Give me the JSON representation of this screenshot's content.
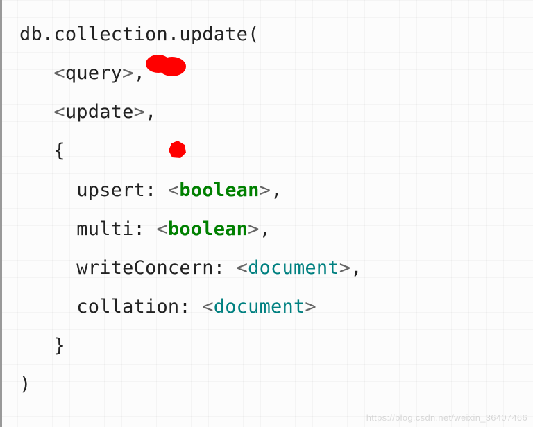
{
  "code": {
    "line1": "db.collection.update(",
    "line2_prefix": "   ",
    "line2_angle_open": "<",
    "line2_word": "query",
    "line2_angle_close": ">",
    "line2_suffix": ",",
    "line3_prefix": "   ",
    "line3_angle_open": "<",
    "line3_word": "update",
    "line3_angle_close": ">",
    "line3_suffix": ",",
    "line4": "   {",
    "line5_prefix": "     upsert: ",
    "line5_angle_open": "<",
    "line5_kw": "boolean",
    "line5_angle_close": ">",
    "line5_suffix": ",",
    "line6_prefix": "     multi: ",
    "line6_angle_open": "<",
    "line6_kw": "boolean",
    "line6_angle_close": ">",
    "line6_suffix": ",",
    "line7_prefix": "     writeConcern: ",
    "line7_angle_open": "<",
    "line7_doc": "document",
    "line7_angle_close": ">",
    "line7_suffix": ",",
    "line8_prefix": "     collation: ",
    "line8_angle_open": "<",
    "line8_doc": "document",
    "line8_angle_close": ">",
    "line9": "   }",
    "line10": ")"
  },
  "watermark": "https://blog.csdn.net/weixin_36407466",
  "annotations": {
    "blob1": "red-mark",
    "blob2": "red-mark"
  }
}
